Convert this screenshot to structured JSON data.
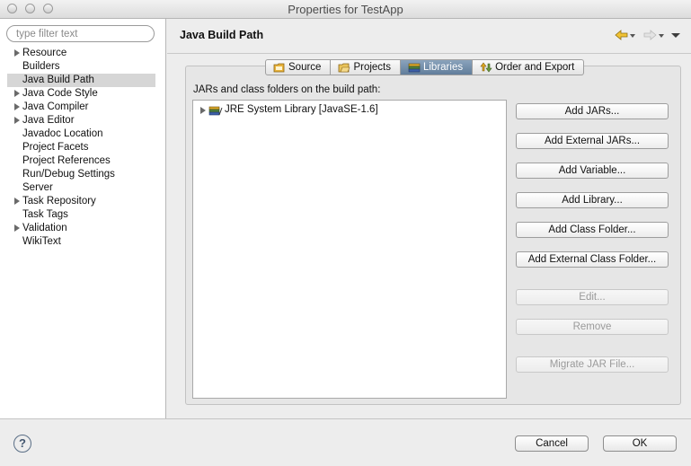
{
  "window": {
    "title": "Properties for TestApp"
  },
  "sidebar": {
    "filter_placeholder": "type filter text",
    "items": [
      {
        "label": "Resource",
        "expandable": true
      },
      {
        "label": "Builders",
        "expandable": false
      },
      {
        "label": "Java Build Path",
        "expandable": false,
        "selected": true
      },
      {
        "label": "Java Code Style",
        "expandable": true
      },
      {
        "label": "Java Compiler",
        "expandable": true
      },
      {
        "label": "Java Editor",
        "expandable": true
      },
      {
        "label": "Javadoc Location",
        "expandable": false
      },
      {
        "label": "Project Facets",
        "expandable": false
      },
      {
        "label": "Project References",
        "expandable": false
      },
      {
        "label": "Run/Debug Settings",
        "expandable": false
      },
      {
        "label": "Server",
        "expandable": false
      },
      {
        "label": "Task Repository",
        "expandable": true
      },
      {
        "label": "Task Tags",
        "expandable": false
      },
      {
        "label": "Validation",
        "expandable": true
      },
      {
        "label": "WikiText",
        "expandable": false
      }
    ]
  },
  "main": {
    "title": "Java Build Path",
    "nav_icons": [
      "back-arrow-icon",
      "forward-arrow-icon",
      "view-menu-icon"
    ],
    "tabs": [
      {
        "label": "Source",
        "icon": "source-folder-icon"
      },
      {
        "label": "Projects",
        "icon": "projects-icon"
      },
      {
        "label": "Libraries",
        "icon": "libraries-icon",
        "active": true
      },
      {
        "label": "Order and Export",
        "icon": "order-export-icon"
      }
    ],
    "build_path_label": "JARs and class folders on the build path:",
    "libraries": [
      {
        "label": "JRE System Library [JavaSE-1.6]",
        "icon": "library-icon"
      }
    ],
    "buttons": {
      "add_jars": "Add JARs...",
      "add_external_jars": "Add External JARs...",
      "add_variable": "Add Variable...",
      "add_library": "Add Library...",
      "add_class_folder": "Add Class Folder...",
      "add_external_class_folder": "Add External Class Folder...",
      "edit": "Edit...",
      "remove": "Remove",
      "migrate_jar": "Migrate JAR File..."
    }
  },
  "footer": {
    "help": "?",
    "cancel": "Cancel",
    "ok": "OK"
  },
  "colors": {
    "active_tab": "#6f8aa8",
    "selection": "#d6d6d6",
    "background": "#ededed"
  }
}
